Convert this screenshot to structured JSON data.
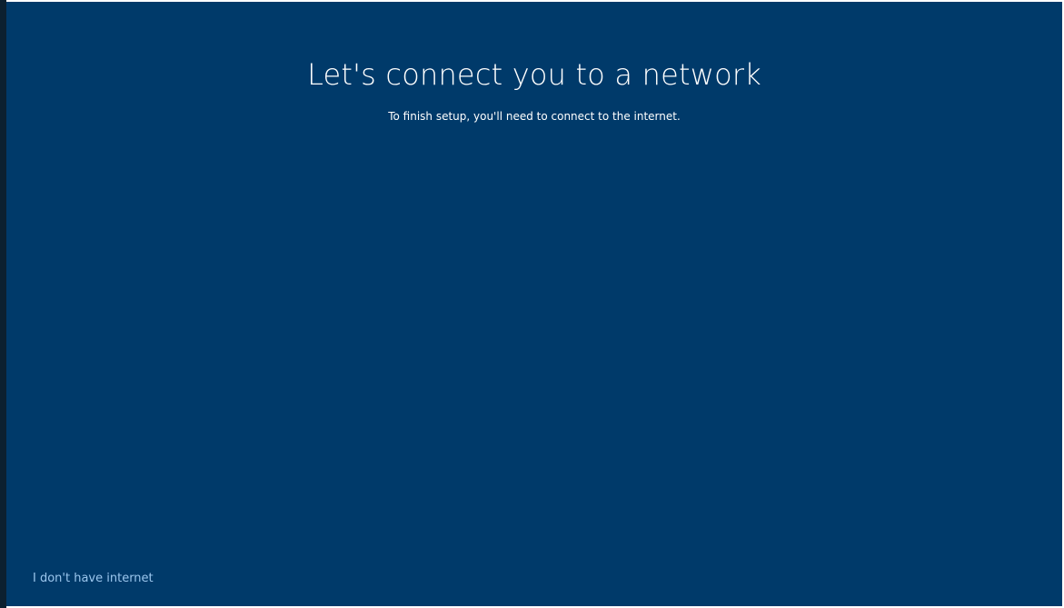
{
  "setup": {
    "title": "Let's connect you to a network",
    "subtitle": "To finish setup, you'll need to connect to the internet.",
    "no_internet_link": "I don't have internet"
  },
  "colors": {
    "background": "#003a6a",
    "text": "#ffffff",
    "link": "#9cc7ee"
  }
}
